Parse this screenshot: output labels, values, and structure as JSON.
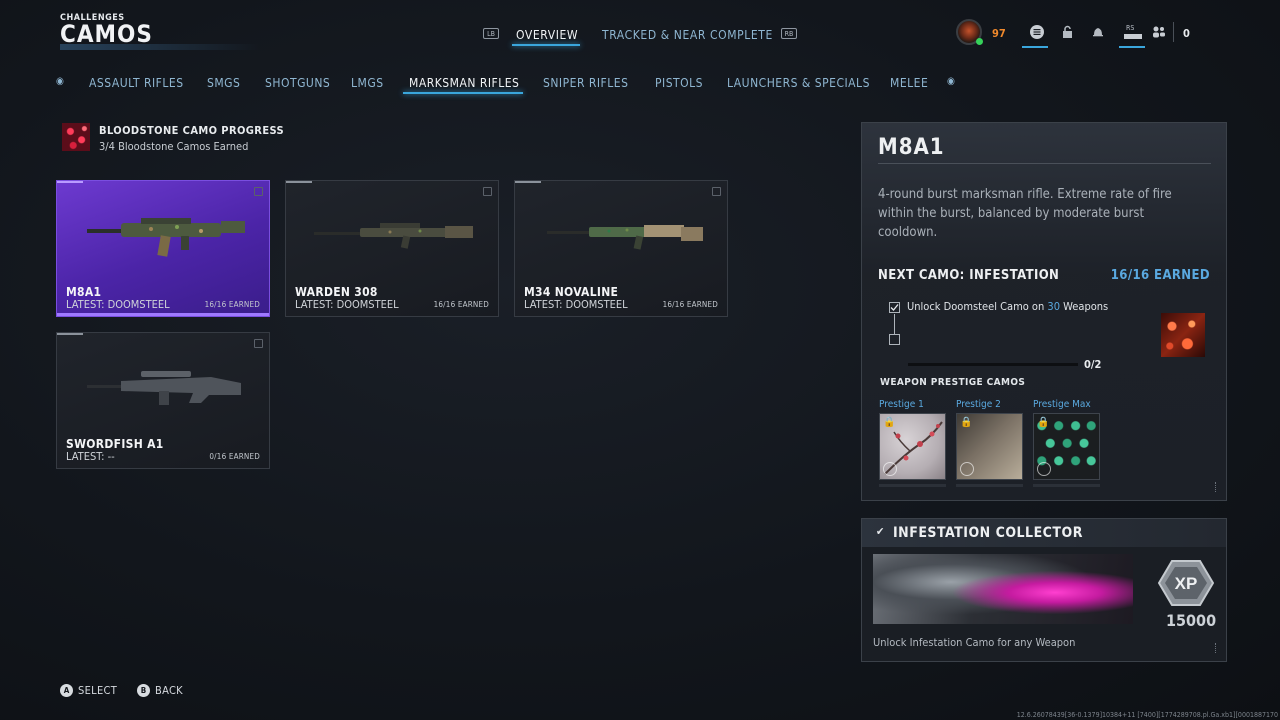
{
  "header": {
    "crumb": "CHALLENGES",
    "title": "CAMOS",
    "lb_hint": "LB",
    "rb_hint": "RB",
    "tabs": [
      {
        "label": "OVERVIEW",
        "active": true
      },
      {
        "label": "TRACKED & NEAR COMPLETE",
        "active": false
      }
    ]
  },
  "status": {
    "level": "97",
    "cp_count": "0",
    "rs_hint": "RS",
    "icons": [
      "menu-icon",
      "lock-icon",
      "bell-icon",
      "social-icon",
      "friends-icon"
    ]
  },
  "categories": [
    {
      "label": "ASSAULT RIFLES",
      "active": false
    },
    {
      "label": "SMGS",
      "active": false
    },
    {
      "label": "SHOTGUNS",
      "active": false
    },
    {
      "label": "LMGS",
      "active": false
    },
    {
      "label": "MARKSMAN RIFLES",
      "active": true
    },
    {
      "label": "SNIPER RIFLES",
      "active": false
    },
    {
      "label": "PISTOLS",
      "active": false
    },
    {
      "label": "LAUNCHERS & SPECIALS",
      "active": false
    },
    {
      "label": "MELEE",
      "active": false
    }
  ],
  "progress": {
    "title": "BLOODSTONE CAMO PROGRESS",
    "subtitle": "3/4 Bloodstone Camos Earned"
  },
  "weapons": [
    {
      "name": "M8A1",
      "latest": "LATEST: DOOMSTEEL",
      "earned": "16/16 EARNED",
      "selected": true
    },
    {
      "name": "WARDEN 308",
      "latest": "LATEST: DOOMSTEEL",
      "earned": "16/16 EARNED",
      "selected": false
    },
    {
      "name": "M34 NOVALINE",
      "latest": "LATEST: DOOMSTEEL",
      "earned": "16/16 EARNED",
      "selected": false
    },
    {
      "name": "SWORDFISH A1",
      "latest": "LATEST: --",
      "earned": "0/16 EARNED",
      "selected": false
    }
  ],
  "detail": {
    "name": "M8A1",
    "description": "4-round burst marksman rifle. Extreme rate of fire within the burst, balanced by moderate burst cooldown.",
    "next_camo_label": "NEXT CAMO: INFESTATION",
    "next_camo_earned": "16/16 EARNED",
    "requirement_prefix": "Unlock Doomsteel Camo on ",
    "requirement_count": "30",
    "requirement_suffix": " Weapons",
    "progress_text": "0/2",
    "progress_fraction": 0.0,
    "prestige_title": "WEAPON PRESTIGE CAMOS",
    "prestige": [
      {
        "label": "Prestige 1"
      },
      {
        "label": "Prestige 2"
      },
      {
        "label": "Prestige Max"
      }
    ]
  },
  "collector": {
    "title": "INFESTATION COLLECTOR",
    "xp_label": "XP",
    "xp_value": "15000",
    "description": "Unlock Infestation Camo for any Weapon"
  },
  "footer": {
    "select_key": "A",
    "select_label": "SELECT",
    "back_key": "B",
    "back_label": "BACK",
    "build": "12.6.26078439[36-0.1379]10384+11 [7400][1774289708.pl.Ga.xb1][0001887170"
  },
  "colors": {
    "accent_blue": "#3aa6dc",
    "selected_purple": "#5a2fc0",
    "level_orange": "#f0892c",
    "earned_blue": "#5aa9e0"
  }
}
